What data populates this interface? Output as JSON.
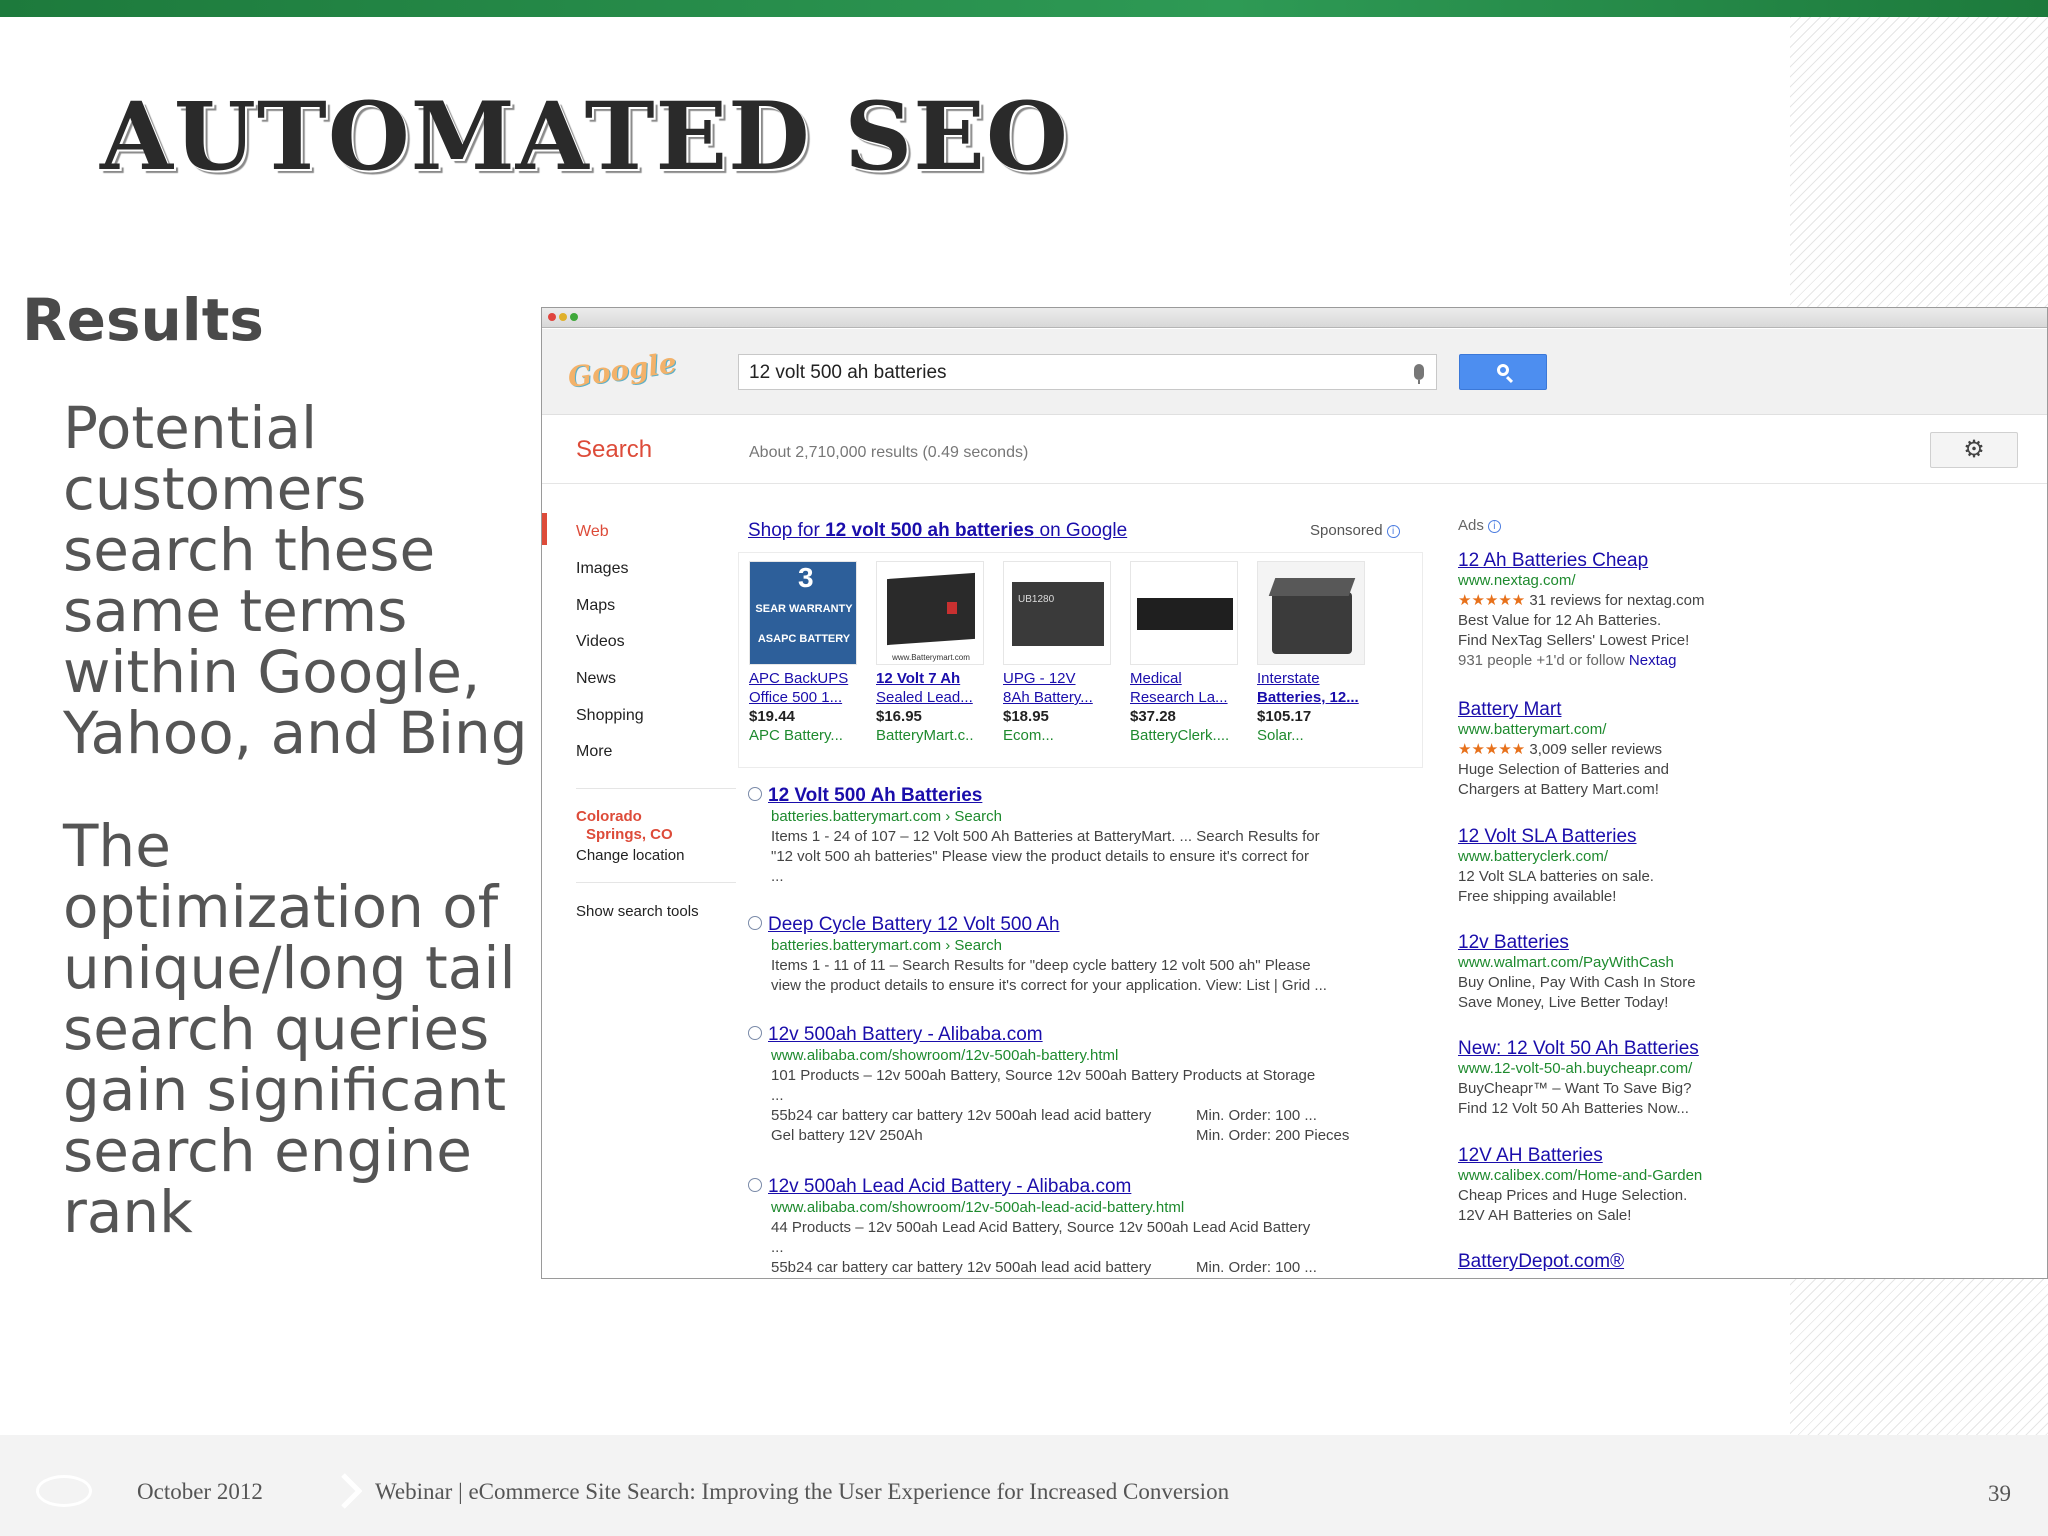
{
  "slide": {
    "title": "AUTOMATED SEO",
    "section_heading": "Results",
    "bullets": [
      "Potential customers search these same terms within Google, Yahoo, and Bing",
      "The optimization of unique/long tail search queries gain significant search engine rank"
    ]
  },
  "browser": {
    "logo_text": "Google",
    "search_query": "12 volt 500 ah batteries",
    "search_label": "Search",
    "result_stats": "About 2,710,000 results (0.49 seconds)",
    "nav_items": [
      "Web",
      "Images",
      "Maps",
      "Videos",
      "News",
      "Shopping",
      "More"
    ],
    "location_line1": "Colorado",
    "location_line2": "Springs, CO",
    "change_location": "Change location",
    "show_search_tools": "Show search tools",
    "shopping": {
      "heading_prefix": "Shop for ",
      "heading_query": "12 volt 500 ah batteries",
      "heading_suffix": " on Google",
      "sponsored": "Sponsored",
      "products": [
        {
          "name1": "APC BackUPS",
          "name2": "Office 500 1...",
          "price": "$19.44",
          "store": "APC Battery..."
        },
        {
          "name1": "12 Volt 7 Ah",
          "name2": "Sealed Lead...",
          "price": "$16.95",
          "store": "BatteryMart.c.."
        },
        {
          "name1": "UPG - 12V",
          "name2": "8Ah Battery...",
          "price": "$18.95",
          "store": "Ecom..."
        },
        {
          "name1": "Medical",
          "name2": "Research La...",
          "price": "$37.28",
          "store": "BatteryClerk...."
        },
        {
          "name1": "Interstate",
          "name2": "Batteries, 12...",
          "price": "$105.17",
          "store": "Solar..."
        }
      ],
      "thumb_texts": [
        "SEAR WARRANTY",
        "ASAPC BATTERY",
        "www.Batterymart.com",
        "UB1280"
      ]
    },
    "results": [
      {
        "title": "12 Volt 500 Ah Batteries",
        "url": "batteries.batterymart.com › Search",
        "desc1": "Items 1 - 24 of 107 – 12 Volt 500 Ah Batteries at BatteryMart. ... Search Results for",
        "desc2": "\"12 volt 500 ah batteries\" Please view the product details to ensure it's correct for",
        "desc3": "..."
      },
      {
        "title": "Deep Cycle Battery 12 Volt 500 Ah",
        "url": "batteries.batterymart.com › Search",
        "desc1": "Items 1 - 11 of 11 – Search Results for \"deep cycle battery 12 volt 500 ah\" Please",
        "desc2": "view the product details to ensure it's correct for your application. View: List | Grid ..."
      },
      {
        "title": "12v 500ah Battery - Alibaba.com",
        "url": "www.alibaba.com/showroom/12v-500ah-battery.html",
        "desc1": "101 Products – 12v 500ah Battery, Source 12v 500ah Battery Products at Storage",
        "desc2": "...",
        "row_a_left": "55b24 car battery car battery 12v 500ah lead acid battery",
        "row_a_right": "Min. Order: 100 ...",
        "row_b_left": "Gel battery 12V 250Ah",
        "row_b_right": "Min. Order: 200 Pieces"
      },
      {
        "title": "12v 500ah Lead Acid Battery - Alibaba.com",
        "url": "www.alibaba.com/showroom/12v-500ah-lead-acid-battery.html",
        "desc1": "44 Products – 12v 500ah Lead Acid Battery, Source 12v 500ah Lead Acid Battery",
        "desc2": "...",
        "row_a_left": "55b24 car battery car battery 12v 500ah lead acid battery",
        "row_a_right": "Min. Order: 100 ..."
      }
    ],
    "ads_label": "Ads",
    "ads": [
      {
        "title": "12 Ah Batteries Cheap",
        "url": "www.nextag.com/",
        "stars": "★★★★★",
        "reviews": "31 reviews for nextag.com",
        "line1": "Best Value for 12 Ah Batteries.",
        "line2": "Find NexTag Sellers' Lowest Price!",
        "line3a": "931 people +1'd or follow ",
        "line3b": "Nextag"
      },
      {
        "title": "Battery Mart",
        "url": "www.batterymart.com/",
        "stars": "★★★★★",
        "reviews": "3,009 seller reviews",
        "line1": "Huge Selection of Batteries and",
        "line2": "Chargers at Battery Mart.com!"
      },
      {
        "title": "12 Volt SLA Batteries",
        "url": "www.batteryclerk.com/",
        "line1": "12 Volt SLA batteries on sale.",
        "line2": "Free shipping available!"
      },
      {
        "title": "12v Batteries",
        "url": "www.walmart.com/PayWithCash",
        "line1": "Buy Online, Pay With Cash In Store",
        "line2": "Save Money, Live Better Today!"
      },
      {
        "title": "New: 12 Volt 50 Ah Batteries",
        "url": "www.12-volt-50-ah.buycheapr.com/",
        "line1": "BuyCheapr™ – Want To Save Big?",
        "line2": "Find 12 Volt 50 Ah Batteries Now..."
      },
      {
        "title": "12V AH Batteries",
        "url": "www.calibex.com/Home-and-Garden",
        "line1": "Cheap Prices and Huge Selection.",
        "line2": "12V AH Batteries on Sale!"
      },
      {
        "title": "BatteryDepot.com®"
      }
    ]
  },
  "footer": {
    "date": "October 2012",
    "text": "Webinar | eCommerce Site Search: Improving the User Experience for Increased Conversion",
    "page": "39"
  },
  "colors": {
    "accent_green": "#1d7a3c",
    "link_blue": "#1a0dab",
    "url_green": "#1e8a2e",
    "google_red": "#dd4b39",
    "search_button_blue": "#4d8ef0"
  }
}
